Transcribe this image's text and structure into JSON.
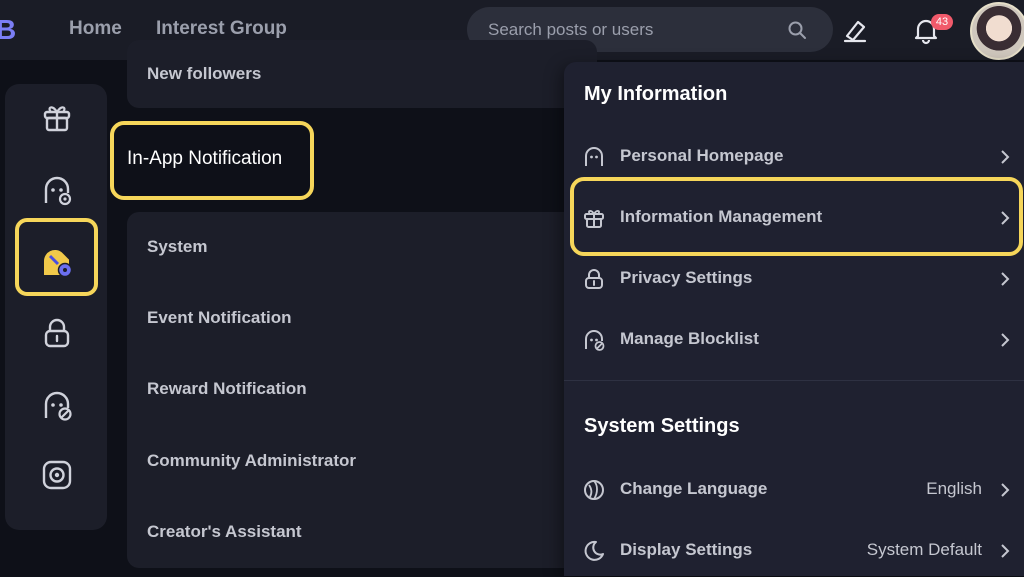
{
  "header": {
    "logo": "B",
    "nav": [
      "Home",
      "Interest Group"
    ],
    "search_placeholder": "Search posts or users",
    "notification_count": "43",
    "icons": [
      "pencil-icon",
      "bell-icon",
      "avatar"
    ]
  },
  "sidebar": {
    "icons": [
      "gift-icon",
      "user-gear-icon",
      "notification-settings-icon",
      "lock-icon",
      "user-block-icon",
      "settings-gear-icon"
    ],
    "active_index": 2
  },
  "main": {
    "top_item": "New followers",
    "section_title": "In-App Notification",
    "items": [
      "System",
      "Event Notification",
      "Reward Notification",
      "Community Administrator",
      "Creator's Assistant"
    ]
  },
  "dropdown": {
    "my_info_heading": "My Information",
    "my_info_items": [
      {
        "label": "Personal Homepage",
        "icon": "user-icon"
      },
      {
        "label": "Information Management",
        "icon": "gift-icon"
      },
      {
        "label": "Privacy Settings",
        "icon": "lock-icon"
      },
      {
        "label": "Manage Blocklist",
        "icon": "user-block-icon"
      }
    ],
    "system_heading": "System Settings",
    "system_items": [
      {
        "label": "Change Language",
        "value": "English",
        "icon": "globe-icon"
      },
      {
        "label": "Display Settings",
        "value": "System Default",
        "icon": "moon-icon"
      }
    ]
  },
  "colors": {
    "highlight": "#f6d65a",
    "accent": "#7b7ef5",
    "badge": "#f15a6b"
  }
}
